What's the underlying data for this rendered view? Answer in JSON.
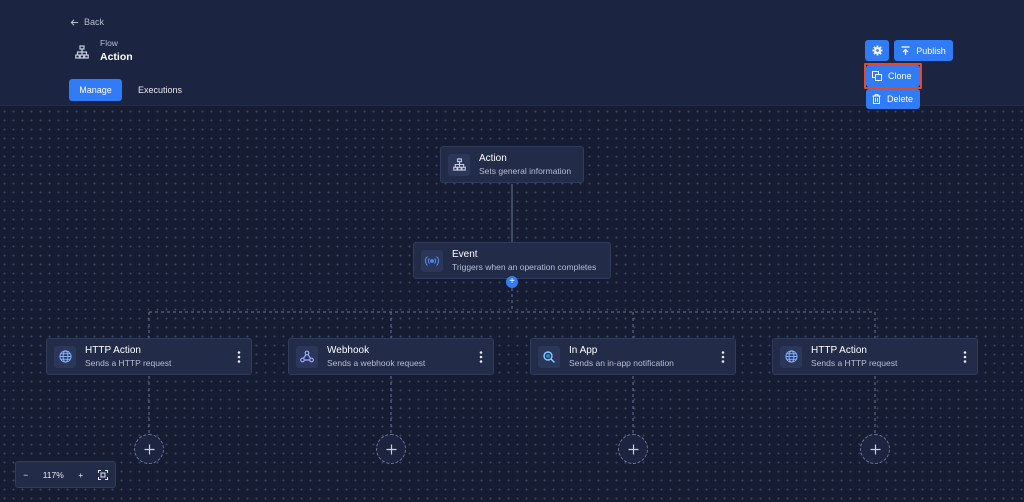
{
  "header": {
    "back_label": "Back",
    "flow_label": "Flow",
    "flow_title": "Action",
    "tabs": [
      {
        "label": "Manage",
        "active": true
      },
      {
        "label": "Executions",
        "active": false
      }
    ],
    "actions": {
      "settings_icon": "gear-icon",
      "publish_label": "Publish"
    },
    "menu": {
      "clone_label": "Clone",
      "delete_label": "Delete"
    }
  },
  "flow": {
    "root": {
      "title": "Action",
      "subtitle": "Sets general information",
      "icon": "sitemap-icon"
    },
    "event": {
      "title": "Event",
      "subtitle": "Triggers when an operation completes",
      "icon": "broadcast-icon"
    },
    "children": [
      {
        "title": "HTTP Action",
        "subtitle": "Sends a HTTP request",
        "icon": "globe-icon"
      },
      {
        "title": "Webhook",
        "subtitle": "Sends a webhook request",
        "icon": "webhook-icon"
      },
      {
        "title": "In App",
        "subtitle": "Sends an in-app notification",
        "icon": "search-notification-icon"
      },
      {
        "title": "HTTP Action",
        "subtitle": "Sends a HTTP request",
        "icon": "globe-icon"
      }
    ]
  },
  "zoom": {
    "minus": "−",
    "level": "117%",
    "plus": "+"
  },
  "colors": {
    "accent": "#2f7cf6",
    "background": "#161d33",
    "highlight": "#e24a2e"
  }
}
